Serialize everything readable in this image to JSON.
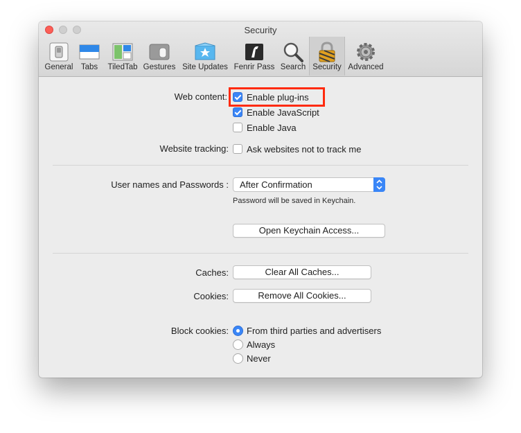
{
  "window": {
    "title": "Security"
  },
  "toolbar": {
    "items": [
      {
        "label": "General",
        "icon": "general-switch-icon"
      },
      {
        "label": "Tabs",
        "icon": "tabs-icon"
      },
      {
        "label": "TiledTab",
        "icon": "tiled-tab-icon"
      },
      {
        "label": "Gestures",
        "icon": "gestures-icon"
      },
      {
        "label": "Site Updates",
        "icon": "site-updates-icon"
      },
      {
        "label": "Fenrir Pass",
        "icon": "fenrir-pass-icon"
      },
      {
        "label": "Search",
        "icon": "magnifier-icon"
      },
      {
        "label": "Security",
        "icon": "padlock-icon"
      },
      {
        "label": "Advanced",
        "icon": "gear-icon"
      }
    ],
    "selected": "Security"
  },
  "web_content": {
    "label": "Web content:",
    "options": [
      {
        "label": "Enable plug-ins",
        "checked": true
      },
      {
        "label": "Enable JavaScript",
        "checked": true
      },
      {
        "label": "Enable Java",
        "checked": false
      }
    ]
  },
  "tracking": {
    "label": "Website tracking:",
    "option": {
      "label": "Ask websites not to track me",
      "checked": false
    }
  },
  "passwords": {
    "label": "User names and Passwords :",
    "selected": "After Confirmation",
    "note": "Password will be saved in Keychain.",
    "open_keychain": "Open Keychain Access..."
  },
  "caches": {
    "label": "Caches:",
    "button": "Clear All Caches..."
  },
  "cookies": {
    "label": "Cookies:",
    "button": "Remove All Cookies..."
  },
  "block_cookies": {
    "label": "Block cookies:",
    "options": [
      {
        "label": "From third parties and advertisers",
        "selected": true
      },
      {
        "label": "Always",
        "selected": false
      },
      {
        "label": "Never",
        "selected": false
      }
    ]
  },
  "colors": {
    "accent": "#3a86f7",
    "highlight": "#ff2a0d",
    "close": "#fc5f57"
  }
}
